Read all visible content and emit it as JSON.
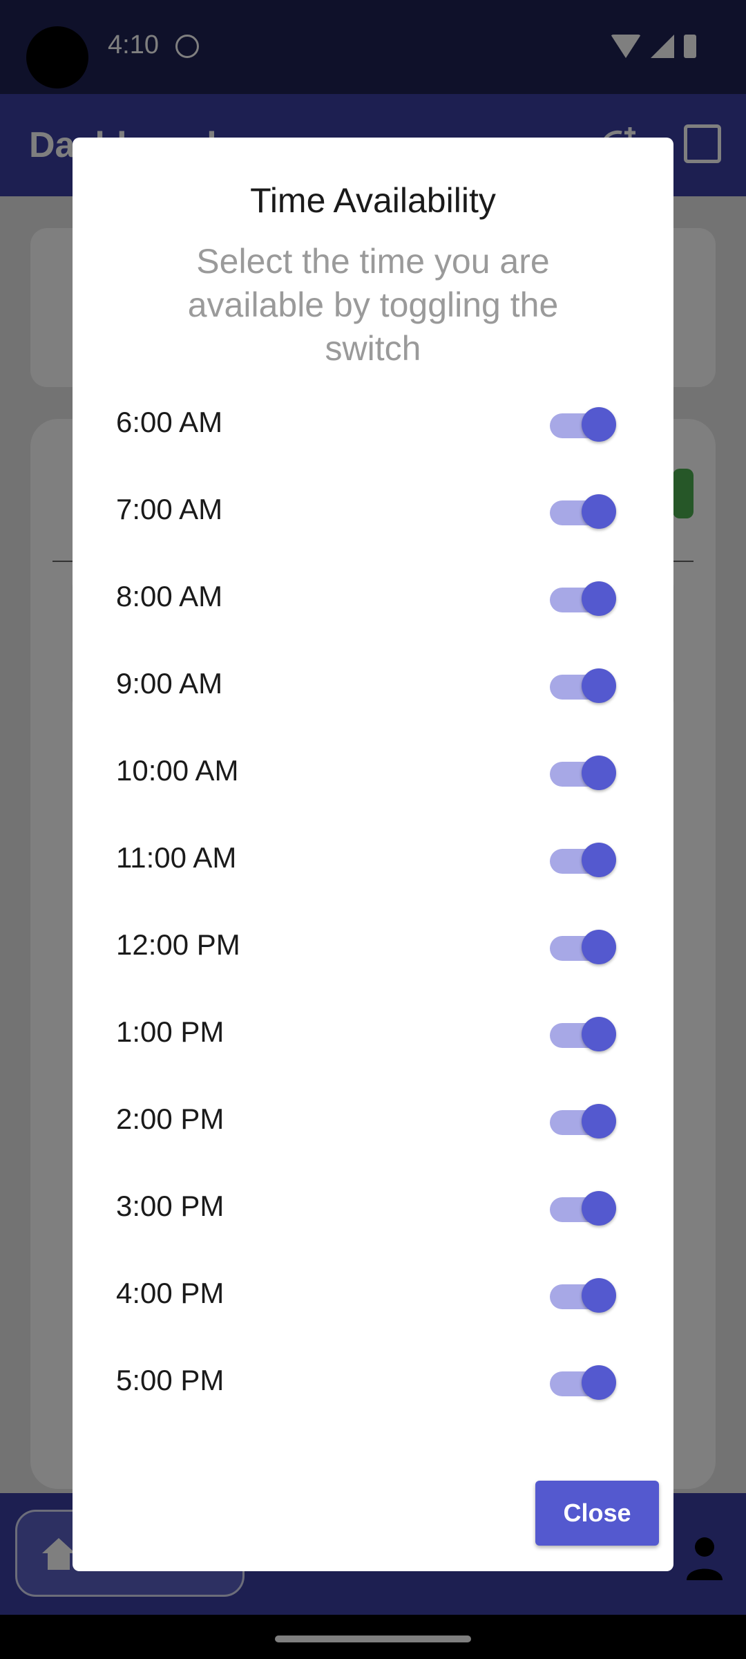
{
  "status_bar": {
    "time": "4:10"
  },
  "app_bar": {
    "title": "Dashboard"
  },
  "dialog": {
    "title": "Time Availability",
    "subtitle": "Select the time you are available by toggling the switch",
    "close_label": "Close",
    "slots": [
      {
        "label": "6:00 AM",
        "enabled": true
      },
      {
        "label": "7:00 AM",
        "enabled": true
      },
      {
        "label": "8:00 AM",
        "enabled": true
      },
      {
        "label": "9:00 AM",
        "enabled": true
      },
      {
        "label": "10:00 AM",
        "enabled": true
      },
      {
        "label": "11:00 AM",
        "enabled": true
      },
      {
        "label": "12:00 PM",
        "enabled": true
      },
      {
        "label": "1:00 PM",
        "enabled": true
      },
      {
        "label": "2:00 PM",
        "enabled": true
      },
      {
        "label": "3:00 PM",
        "enabled": true
      },
      {
        "label": "4:00 PM",
        "enabled": true
      },
      {
        "label": "5:00 PM",
        "enabled": true
      }
    ]
  },
  "colors": {
    "accent": "#5459cf",
    "track_on": "#a7a8e6",
    "app_bar": "#3a3fa3",
    "status_bar": "#1f2255"
  }
}
